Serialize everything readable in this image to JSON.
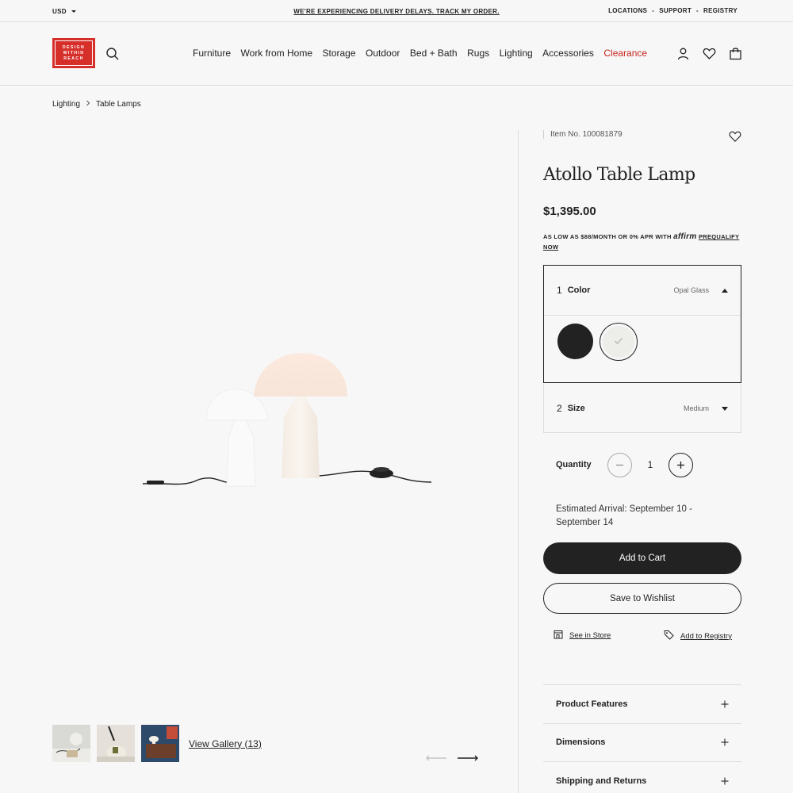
{
  "topbar": {
    "currency": "USD",
    "promo": "WE'RE EXPERIENCING DELIVERY DELAYS. TRACK MY ORDER.",
    "links": [
      "LOCATIONS",
      "SUPPORT",
      "REGISTRY"
    ],
    "separator": "-"
  },
  "header": {
    "logo_lines": [
      "DESIGN",
      "WITHIN",
      "REACH"
    ],
    "nav": [
      "Furniture",
      "Work from Home",
      "Storage",
      "Outdoor",
      "Bed + Bath",
      "Rugs",
      "Lighting",
      "Accessories",
      "Clearance"
    ],
    "icons": [
      "account-icon",
      "heart-icon",
      "bag-icon"
    ]
  },
  "breadcrumb": [
    "Lighting",
    "Table Lamps"
  ],
  "gallery": {
    "view_label": "View Gallery (13)",
    "thumbnail_count": 3
  },
  "product": {
    "item_no": "Item No. 100081879",
    "title": "Atollo Table Lamp",
    "price": "$1,395.00",
    "affirm": {
      "prefix": "AS LOW AS $88/MONTH OR 0% APR WITH",
      "brand": "affirm",
      "link": "PREQUALIFY NOW"
    },
    "options": {
      "color": {
        "num": "1",
        "label": "Color",
        "value": "Opal Glass",
        "swatches": [
          "Black",
          "Opal Glass"
        ]
      },
      "size": {
        "num": "2",
        "label": "Size",
        "value": "Medium"
      }
    },
    "quantity": {
      "label": "Quantity",
      "value": "1"
    },
    "arrival": "Estimated Arrival: September 10 - September 14",
    "buttons": {
      "add_to_cart": "Add to Cart",
      "save_to_wishlist": "Save to Wishlist",
      "see_in_store": "See in Store",
      "add_to_registry": "Add to Registry"
    },
    "accordion": [
      "Product Features",
      "Dimensions",
      "Shipping and Returns"
    ]
  },
  "colors": {
    "brand_red": "#d62f2a",
    "clearance_red": "#c7241c",
    "dark": "#222222",
    "background": "#f7f7f7"
  }
}
